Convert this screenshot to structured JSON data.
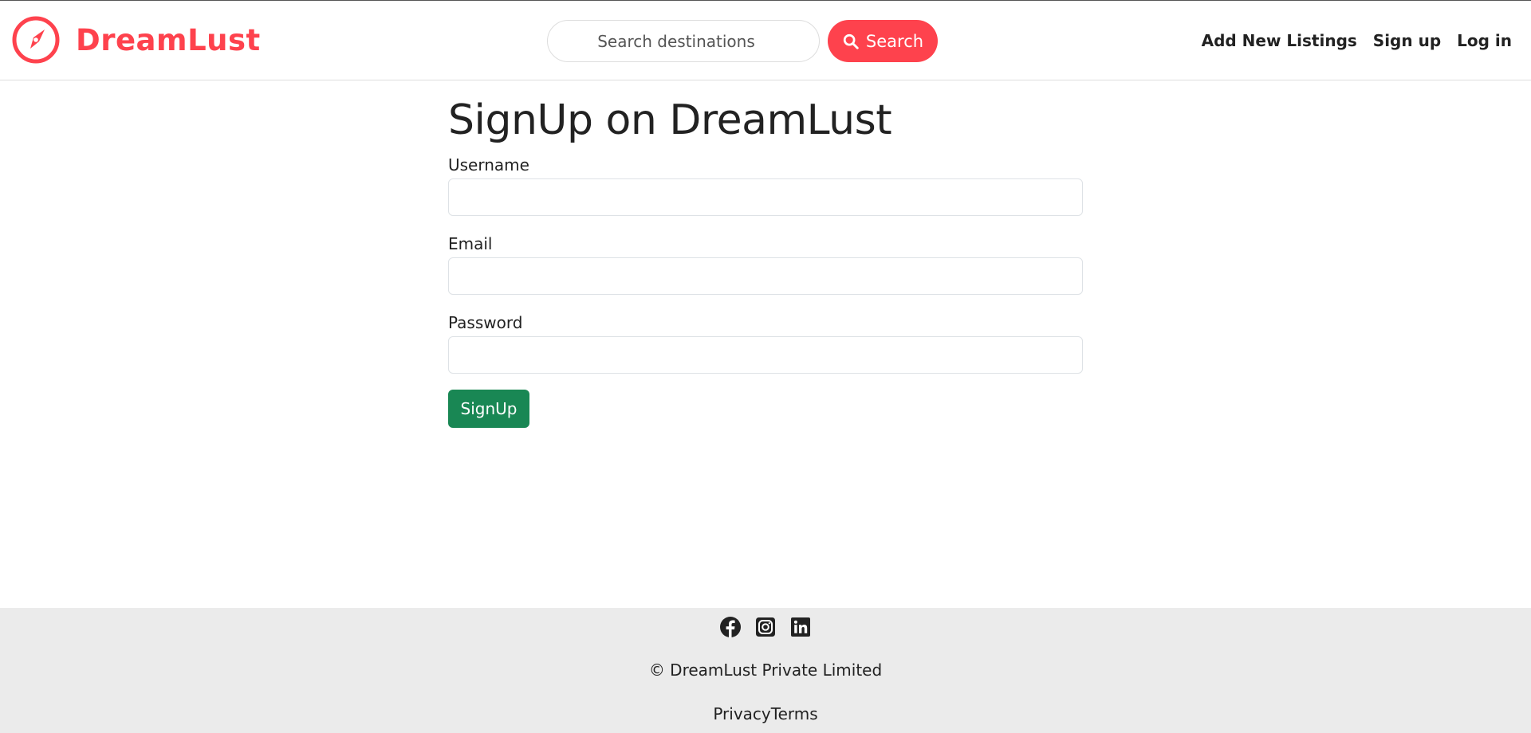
{
  "colors": {
    "brand": "#fe424d",
    "success": "#198754",
    "footer_bg": "#ebebeb",
    "text": "#222222"
  },
  "navbar": {
    "brand_icon": "compass-icon",
    "brand_name": "DreamLust",
    "search": {
      "placeholder": "Search destinations",
      "value": "",
      "button_icon": "search-icon",
      "button_label": "Search"
    },
    "links": {
      "add_listing": "Add New Listings",
      "signup": "Sign up",
      "login": "Log in"
    }
  },
  "form": {
    "title": "SignUp on DreamLust",
    "fields": {
      "username": {
        "label": "Username",
        "value": ""
      },
      "email": {
        "label": "Email",
        "value": ""
      },
      "password": {
        "label": "Password",
        "value": ""
      }
    },
    "submit_label": "SignUp"
  },
  "footer": {
    "social_icons": [
      "facebook-icon",
      "instagram-icon",
      "linkedin-icon"
    ],
    "copyright": "© DreamLust Private Limited",
    "links": {
      "privacy": "Privacy",
      "terms": "Terms"
    }
  }
}
